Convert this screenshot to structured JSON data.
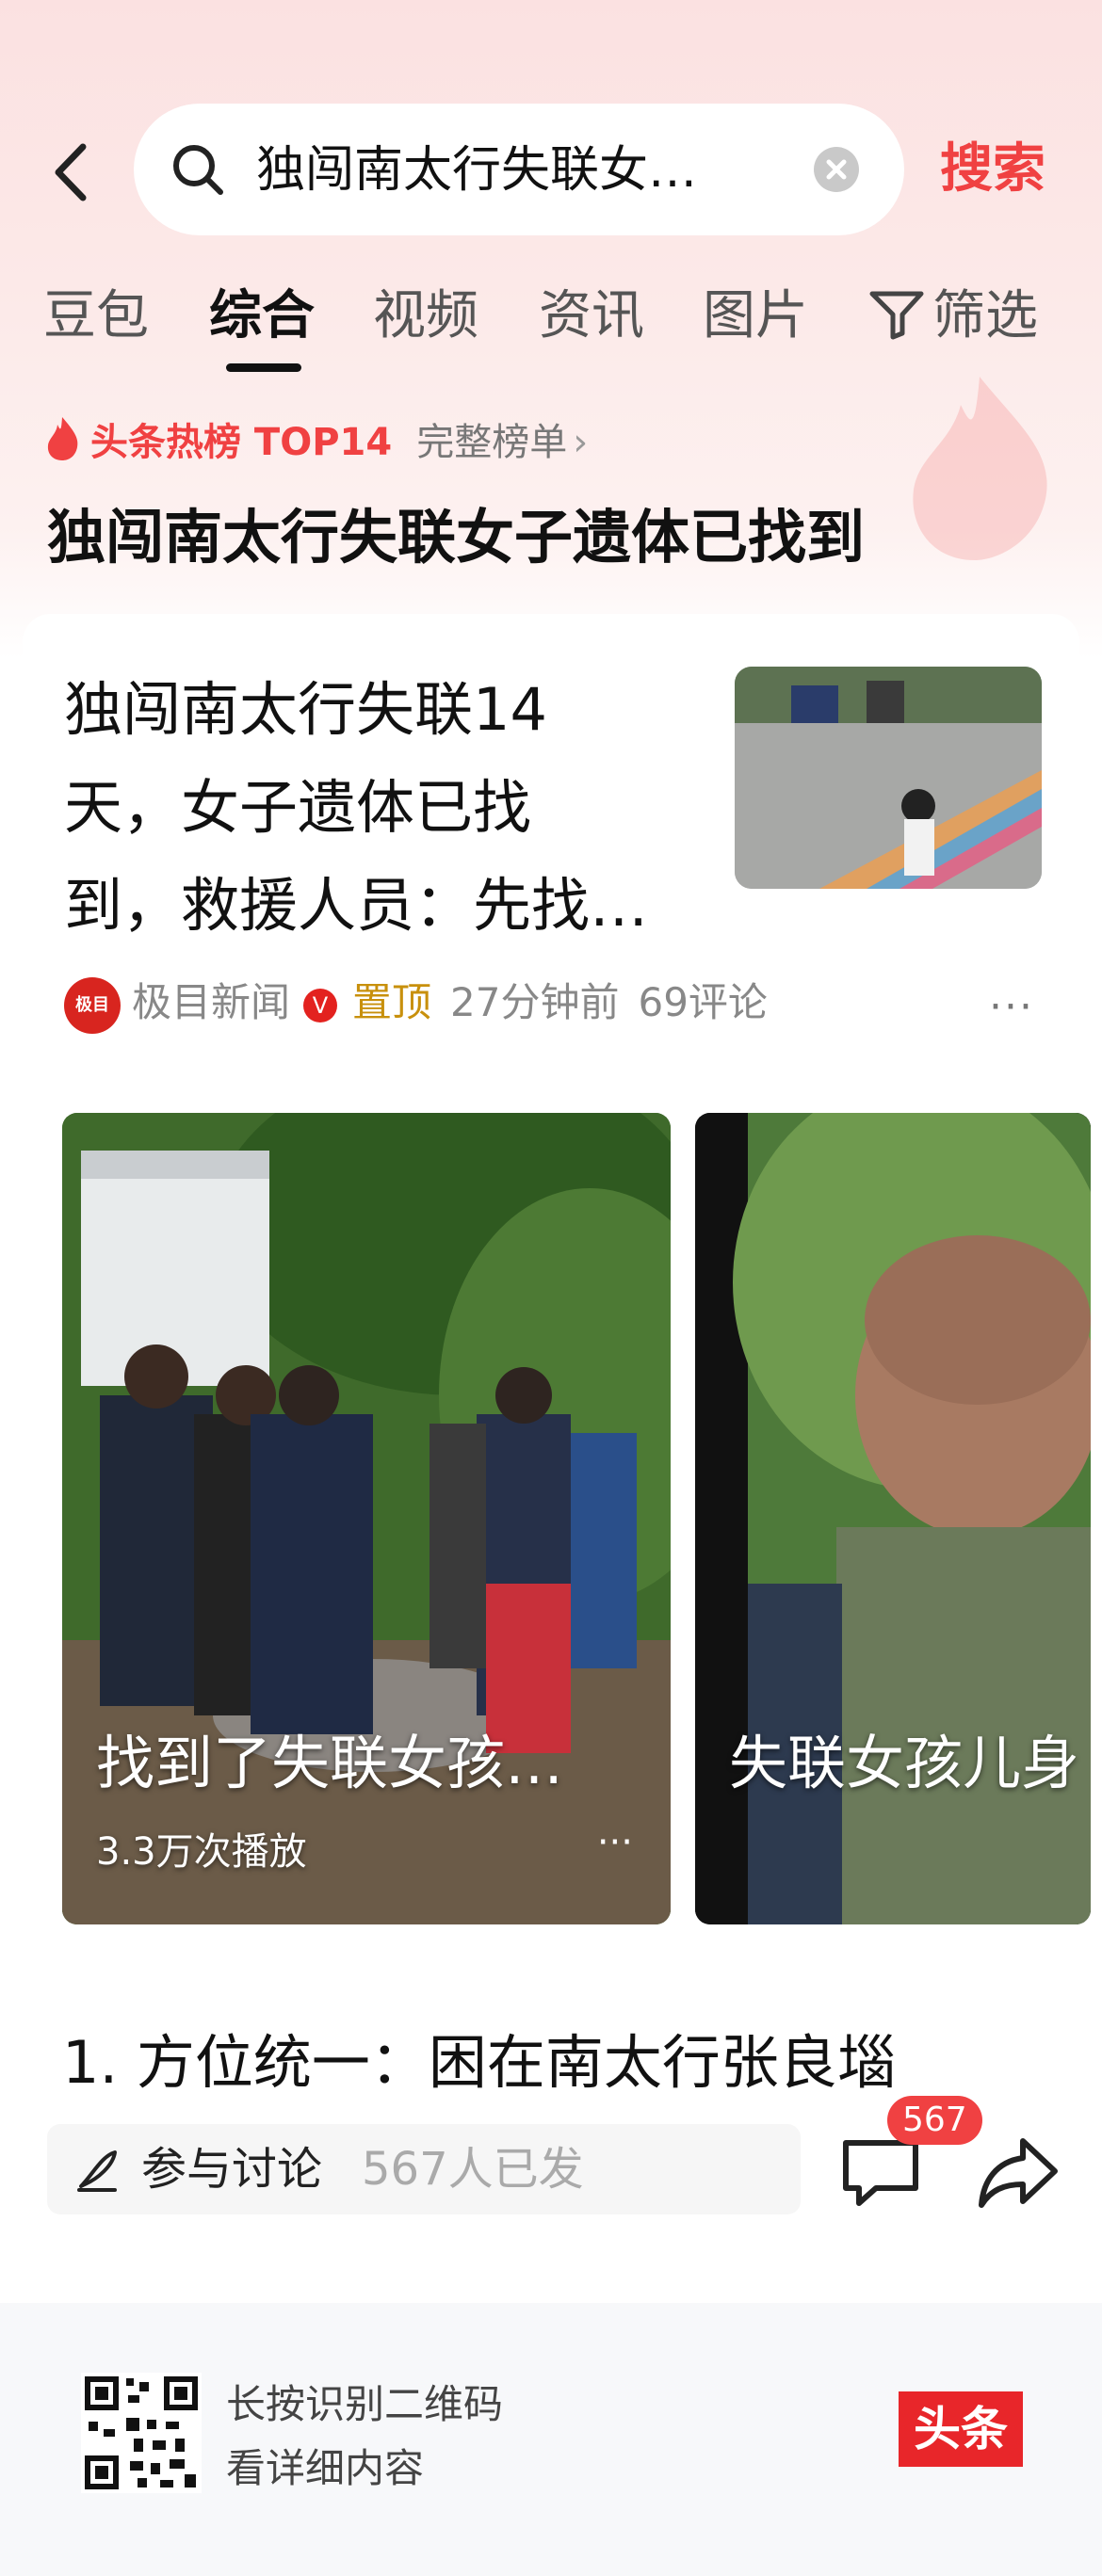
{
  "search": {
    "query": "独闯南太行失联女…",
    "button_label": "搜索"
  },
  "tabs": [
    "豆包",
    "综合",
    "视频",
    "资讯",
    "图片",
    "筛选"
  ],
  "hot": {
    "label": "头条热榜 TOP14",
    "full_list": "完整榜单",
    "title": "独闯南太行失联女子遗体已找到"
  },
  "article": {
    "title_lines": [
      "独闯南太行失联14",
      "天，女子遗体已找",
      "到，救援人员：先找…"
    ],
    "source": "极目新闻",
    "source_avatar_text": "极目",
    "pinned": "置顶",
    "time": "27分钟前",
    "comments": "69评论"
  },
  "videos": [
    {
      "caption": "找到了失联女孩…",
      "plays": "3.3万次播放"
    },
    {
      "caption": "失联女孩儿身",
      "plays": ""
    }
  ],
  "list_item": "1. 方位统一：困在南太行张良堖",
  "discussion": {
    "label": "参与讨论",
    "count": "567人已发",
    "comment_badge": "567"
  },
  "footer": {
    "line1": "长按识别二维码",
    "line2": "看详细内容",
    "brand": "头条"
  },
  "colors": {
    "accent": "#f04142",
    "pinned": "#c8900c"
  }
}
